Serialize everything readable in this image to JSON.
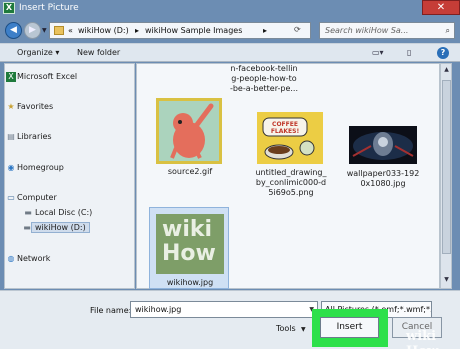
{
  "window": {
    "title": "Insert Picture",
    "app_icon": "X",
    "close_glyph": "✕"
  },
  "address": {
    "crumbs": [
      "«",
      "wikiHow (D:)",
      "▸",
      "wikiHow Sample Images",
      "▸"
    ],
    "refresh_glyph": "⟳",
    "search_placeholder": "Search wikiHow Sa..."
  },
  "toolbar": {
    "organize": "Organize ▾",
    "new_folder": "New folder",
    "help": "?"
  },
  "nav": {
    "items": [
      {
        "label": "Microsoft Excel",
        "icon": "excel-icon",
        "glyph": "X"
      },
      {
        "label": "Favorites",
        "icon": "star-icon",
        "glyph": "★"
      },
      {
        "label": "Libraries",
        "icon": "libraries-icon",
        "glyph": "▤"
      },
      {
        "label": "Homegroup",
        "icon": "homegroup-icon",
        "glyph": "◉"
      },
      {
        "label": "Computer",
        "icon": "computer-icon",
        "glyph": "▭"
      },
      {
        "label": "Local Disc (C:)",
        "icon": "drive-icon",
        "glyph": "▬"
      },
      {
        "label": "wikiHow (D:)",
        "icon": "drive-icon",
        "glyph": "▬"
      },
      {
        "label": "Network",
        "icon": "network-icon",
        "glyph": "◍"
      }
    ]
  },
  "files": {
    "top_caption": [
      "n-facebook-tellin",
      "g-people-how-to",
      "-be-a-better-pe..."
    ],
    "items": [
      {
        "caption": [
          "source2.gif"
        ]
      },
      {
        "caption": [
          "untitled_drawing_",
          "by_conlimic000-d",
          "5i69o5.png"
        ],
        "thumb_text": [
          "COFFEE",
          "FLAKES!"
        ]
      },
      {
        "caption": [
          "wallpaper033-192",
          "0x1080.jpg"
        ]
      },
      {
        "caption": [
          "wikihow.jpg"
        ],
        "thumb_text": [
          "wiki",
          "How"
        ]
      }
    ]
  },
  "bottom": {
    "file_name_label": "File name:",
    "file_name_value": "wikihow.jpg",
    "filter_value": "All Pictures (*.emf;*.wmf;*.jp",
    "tools_label": "Tools",
    "insert_label": "Insert",
    "cancel_label": "Cancel"
  },
  "watermark": "wiki How",
  "colors": {
    "highlight": "#2de04a",
    "thumb_wikihow": "#7e9e68",
    "close": "#c63d37"
  }
}
